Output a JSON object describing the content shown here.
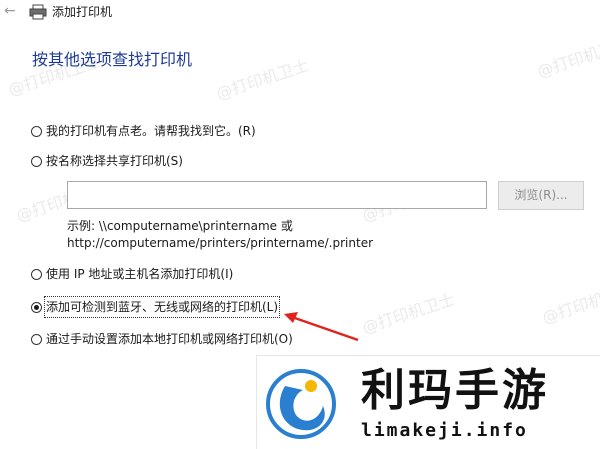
{
  "window": {
    "title": "添加打印机",
    "back_icon": "back-arrow-icon",
    "title_icon": "printer-icon"
  },
  "heading": "按其他选项查找打印机",
  "options": [
    {
      "label": "我的打印机有点老。请帮我找到它。(R)",
      "checked": false
    },
    {
      "label": "按名称选择共享打印机(S)",
      "checked": false
    },
    {
      "label": "使用 IP 地址或主机名添加打印机(I)",
      "checked": false
    },
    {
      "label": "添加可检测到蓝牙、无线或网络的打印机(L)",
      "checked": true
    },
    {
      "label": "通过手动设置添加本地打印机或网络打印机(O)",
      "checked": false
    }
  ],
  "share": {
    "input_value": "",
    "browse_label": "浏览(R)...",
    "example_line1": "示例: \\\\computername\\printername 或",
    "example_line2": "http://computername/printers/printername/.printer"
  },
  "annotation": {
    "arrow_color": "#e0231d"
  },
  "watermarks": [
    "@打印机卫士"
  ],
  "logo": {
    "name_cn": "利玛手游",
    "url": "limakeji.info",
    "colors": {
      "blue": "#2a7fd0",
      "yellow": "#f5b700"
    }
  }
}
